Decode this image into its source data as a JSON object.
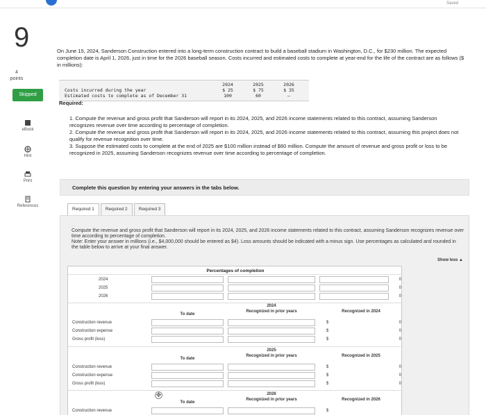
{
  "topbar": {
    "saved": "Saved"
  },
  "question": {
    "number": "9",
    "points_value": "4",
    "points_label": "points",
    "status": "Skipped"
  },
  "tools": [
    {
      "label": "eBook",
      "icon": "book-icon"
    },
    {
      "label": "Hint",
      "icon": "hint-icon"
    },
    {
      "label": "Print",
      "icon": "print-icon"
    },
    {
      "label": "References",
      "icon": "references-icon"
    }
  ],
  "prompt": "On June 15, 2024, Sanderson Construction entered into a long-term construction contract to build a baseball stadium in Washington, D.C., for $230 million. The expected completion date is April 1, 2026, just in time for the 2026 baseball season. Costs incurred and estimated costs to complete at year-end for the life of the contract are as follows ($ in millions):",
  "costs_table": {
    "years": [
      "2024",
      "2025",
      "2026"
    ],
    "rows": [
      {
        "label": "Costs incurred during the year",
        "values": [
          "$ 25",
          "$ 75",
          "$ 35"
        ]
      },
      {
        "label": "Estimated costs to complete as of December 31",
        "values": [
          "100",
          "60",
          "–"
        ]
      }
    ]
  },
  "required_label": "Required:",
  "requirements": [
    "1. Compute the revenue and gross profit that Sanderson will report in its 2024, 2025, and 2026 income statements related to this contract, assuming Sanderson recognizes revenue over time according to percentage of completion.",
    "2. Compute the revenue and gross profit that Sanderson will report in its 2024, 2025, and 2026 income statements related to this contract, assuming this project does not qualify for revenue recognition over time.",
    "3. Suppose the estimated costs to complete at the end of 2025 are $100 million instead of $60 million. Compute the amount of revenue and gross profit or loss to be recognized in 2025, assuming Sanderson recognizes revenue over time according to percentage of completion."
  ],
  "banner": "Complete this question by entering your answers in the tabs below.",
  "tabs": [
    "Required 1",
    "Required 2",
    "Required 3"
  ],
  "instructions": {
    "main": "Compute the revenue and gross profit that Sanderson will report in its 2024, 2025, and 2026 income statements related to this contract, assuming Sanderson recognizes revenue over time according to percentage of completion.",
    "note": "Note: Enter your answer in millions (i.e., $4,000,000 should be entered as $4). Loss amounts should be indicated with a minus sign. Use percentages as calculated and rounded in the table below to arrive at your final answer."
  },
  "show_less": "Show less ▲",
  "grid": {
    "title": "Percentages of completion",
    "pc_years": [
      "2024",
      "2025",
      "2026"
    ],
    "pc_values": [
      "0",
      "0",
      "0"
    ],
    "sections": [
      {
        "year": "2024",
        "to_date": "To date",
        "prior": "Recognized in prior years",
        "current": "Recognized in 2024",
        "rows": [
          "Construction revenue",
          "Construction expense",
          "Gross profit (loss)"
        ],
        "values": [
          "0",
          "0",
          "0"
        ]
      },
      {
        "year": "2025",
        "to_date": "To date",
        "prior": "Recognized in prior years",
        "current": "Recognized in 2025",
        "rows": [
          "Construction revenue",
          "Construction expense",
          "Gross profit (loss)"
        ],
        "values": [
          "0",
          "0",
          "0"
        ]
      },
      {
        "year": "2026",
        "to_date": "To date",
        "prior": "Recognized in prior years",
        "current": "Recognized in 2026",
        "rows": [
          "Construction revenue"
        ],
        "values": []
      }
    ]
  }
}
